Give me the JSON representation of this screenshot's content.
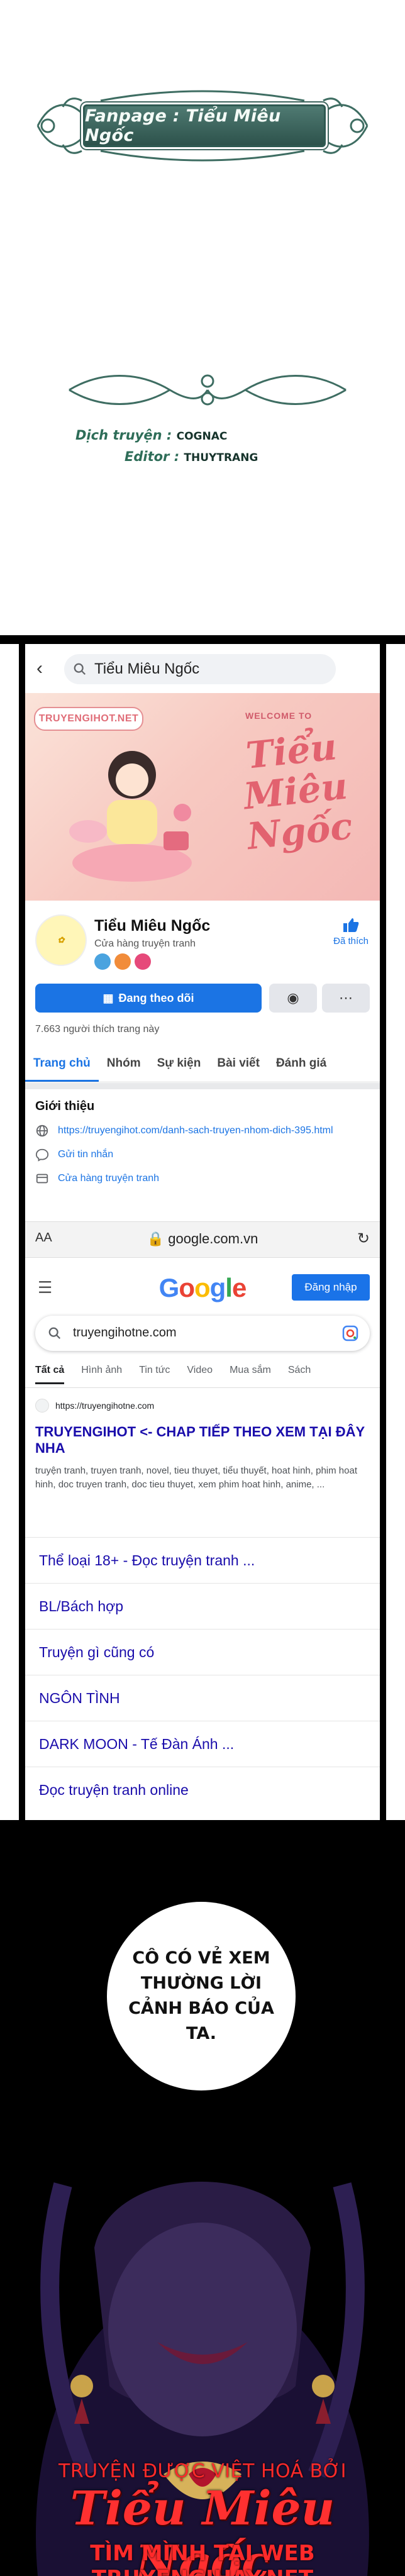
{
  "credits": {
    "fanpage_label": "Fanpage : Tiểu Miêu Ngốc",
    "translator_label": "Dịch truyện :",
    "translator_name": "COGNAC",
    "editor_label": "Editor :",
    "editor_name": "THUYTRANG"
  },
  "fb": {
    "search_text": "Tiểu Miêu Ngốc",
    "cover_logo": "TRUYENGIHOT.NET",
    "cover_welcome": "WELCOME TO",
    "cover_title": "Tiểu Miêu Ngốc",
    "page_name": "Tiểu Miêu Ngốc",
    "page_category": "Cửa hàng truyện tranh",
    "liked_label": "Đã thích",
    "following_button": "Đang theo dõi",
    "likes_count": "7.663 người thích trang này",
    "tabs": [
      "Trang chủ",
      "Nhóm",
      "Sự kiện",
      "Bài viết",
      "Đánh giá"
    ],
    "intro_title": "Giới thiệu",
    "intro_link": "https://truyengihot.com/danh-sach-truyen-nhom-dich-395.html",
    "intro_message": "Gửi tin nhắn",
    "intro_category": "Cửa hàng truyện tranh"
  },
  "browser": {
    "aa": "AA",
    "host": "google.com.vn"
  },
  "google": {
    "logo": "Google",
    "login_button": "Đăng nhập",
    "query": "truyengihotne.com",
    "tabs": [
      "Tất cả",
      "Hình ảnh",
      "Tin tức",
      "Video",
      "Mua sắm",
      "Sách"
    ],
    "result_url": "https://truyengihotne.com",
    "result_title": "TRUYENGIHOT <- CHAP TIẾP THEO XEM TẠI ĐÂY NHA",
    "result_snippet": "truyện tranh, truyen tranh, novel, tieu thuyet, tiểu thuyết, hoat hinh, phim hoat hinh, doc truyen tranh, doc tieu thuyet, xem phim hoat hinh, anime, ...",
    "sitelinks": [
      "Thể loại 18+ - Đọc truyện tranh ...",
      "BL/Bách hợp",
      "Truyện gì cũng có",
      "NGÔN TÌNH",
      "DARK MOON - Tế Đàn Ánh ...",
      "Đọc truyện tranh online"
    ]
  },
  "panel": {
    "bubble_text": "CÔ CÓ VẺ XEM THƯỜNG LỜI CẢNH BÁO CỦA TA.",
    "watermark_line1": "TRUYỆN ĐƯỢC VIỆT HOÁ BỞI",
    "watermark_line2": "Tiểu Miêu Ngốc",
    "watermark_line3": "TÌM MÌNH TẠI WEB TRUYENGIHAY.NET"
  },
  "colors": {
    "fb_blue": "#1b74e4",
    "google_link": "#1a0dab",
    "credit_green": "#2e6d58",
    "watermark_red": "#ff2a2a"
  }
}
